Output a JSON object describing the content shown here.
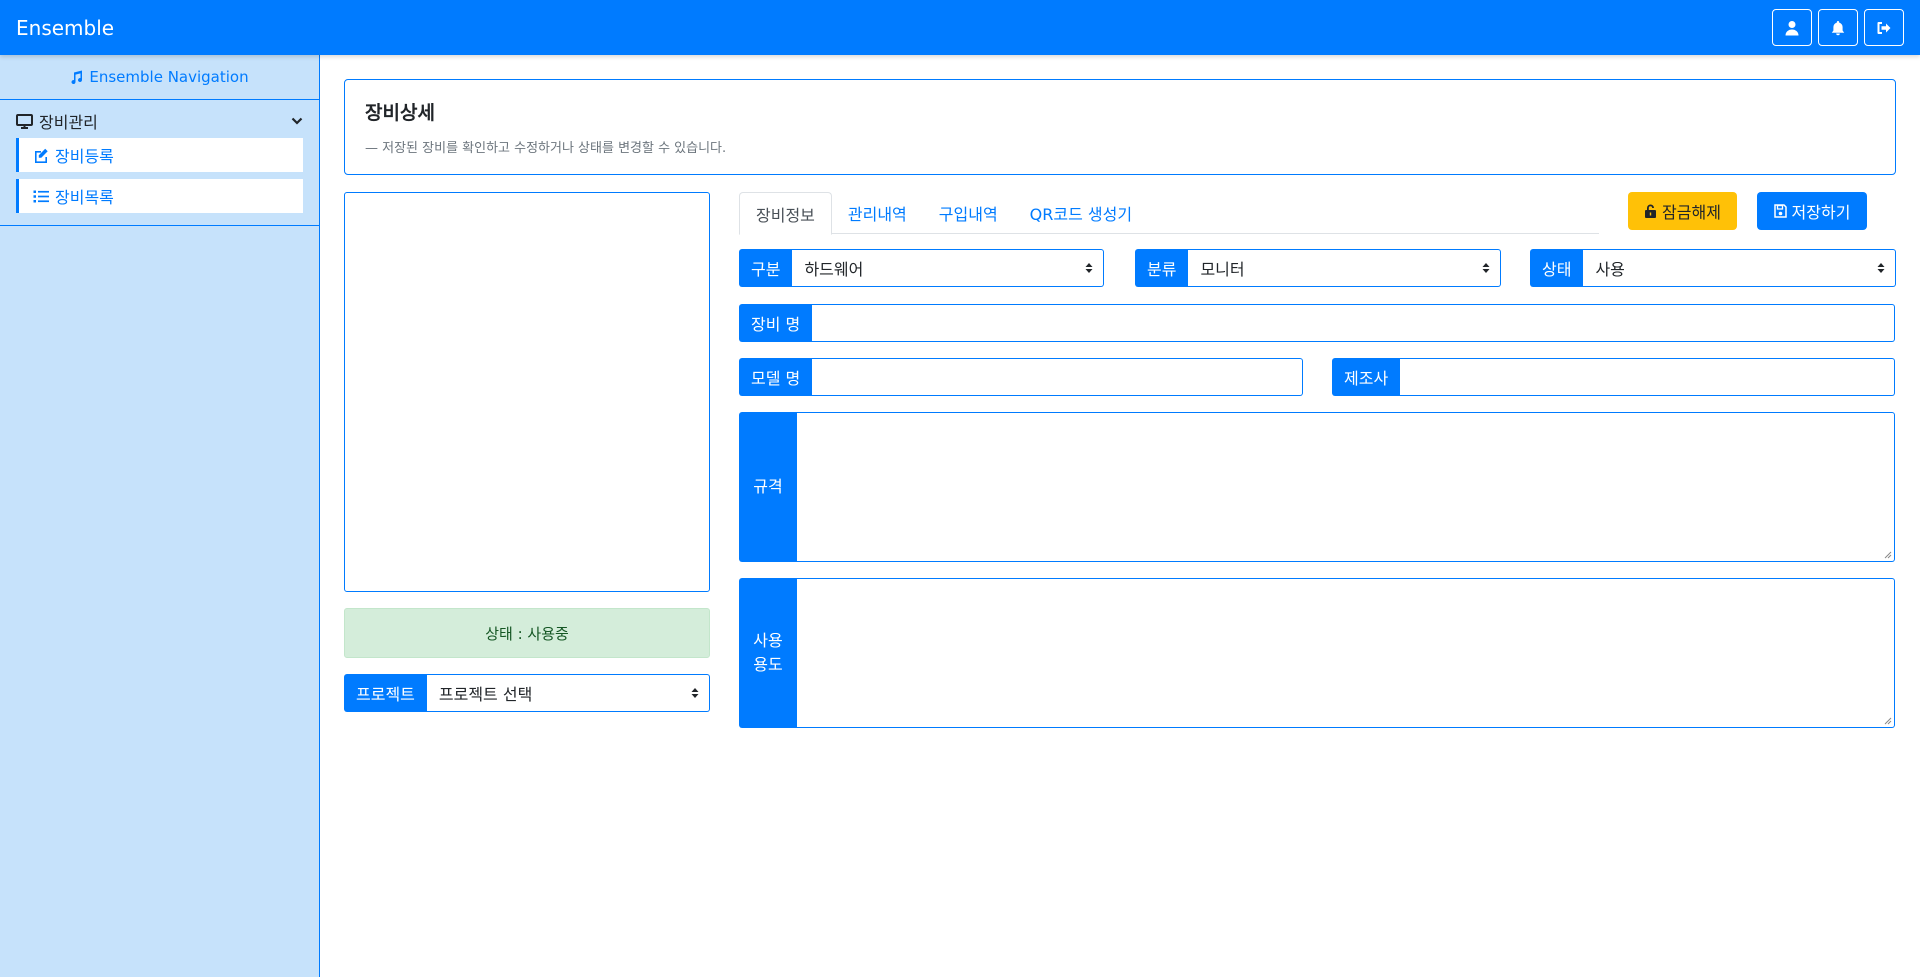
{
  "app": {
    "brand": "Ensemble"
  },
  "topbar": {
    "icons": [
      "user-icon",
      "bell-icon",
      "logout-icon"
    ]
  },
  "sidebar": {
    "header": "Ensemble Navigation",
    "group": {
      "label": "장비관리",
      "items": [
        {
          "label": "장비등록",
          "icon": "edit-icon"
        },
        {
          "label": "장비목록",
          "icon": "list-icon"
        }
      ]
    }
  },
  "page": {
    "title": "장비상세",
    "subtitle": "— 저장된 장비를 확인하고 수정하거나 상태를 변경할 수 있습니다."
  },
  "left_panel": {
    "status_text": "상태 : 사용중",
    "project_label": "프로젝트",
    "project_value": "프로젝트 선택"
  },
  "tabs": [
    {
      "label": "장비정보",
      "active": true
    },
    {
      "label": "관리내역",
      "active": false
    },
    {
      "label": "구입내역",
      "active": false
    },
    {
      "label": "QR코드 생성기",
      "active": false
    }
  ],
  "buttons": {
    "unlock": "잠금해제",
    "save": "저장하기"
  },
  "form": {
    "category_label": "구분",
    "category_value": "하드웨어",
    "class_label": "분류",
    "class_value": "모니터",
    "state_label": "상태",
    "state_value": "사용",
    "name_label": "장비 명",
    "model_label": "모델 명",
    "maker_label": "제조사",
    "spec_label": "규격",
    "usage_label": "사용\n용도"
  },
  "colors": {
    "primary": "#007bff",
    "warning": "#ffc107",
    "sidebar_bg": "#c6e2fb",
    "success_bg": "#d4edda"
  }
}
